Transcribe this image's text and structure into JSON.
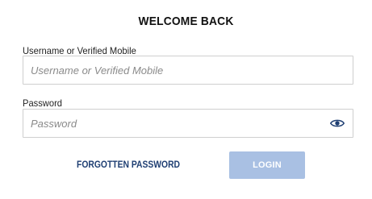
{
  "header": {
    "title": "WELCOME BACK"
  },
  "form": {
    "username": {
      "label": "Username or Verified Mobile",
      "placeholder": "Username or Verified Mobile",
      "value": ""
    },
    "password": {
      "label": "Password",
      "placeholder": "Password",
      "value": "",
      "toggle_icon": "eye-icon"
    },
    "forgot_label": "FORGOTTEN PASSWORD",
    "login_label": "LOGIN"
  },
  "colors": {
    "link": "#1f3f73",
    "login_button_bg": "#a9c0e3",
    "eye_icon": "#1f3f73",
    "field_border": "#cfcfcf"
  }
}
